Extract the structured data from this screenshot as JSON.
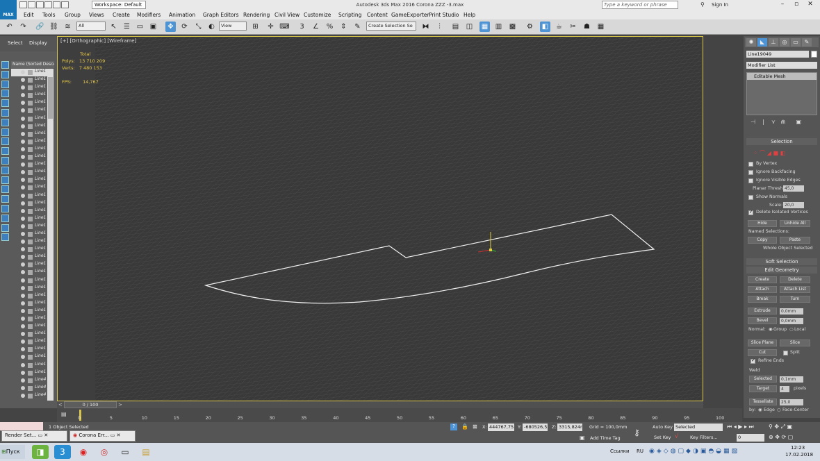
{
  "titlebar": {
    "logo": "MAX",
    "workspace": "Workspace: Default",
    "title": "Autodesk 3ds Max 2016     Corona ZZZ -3.max",
    "search_placeholder": "Type a keyword or phrase",
    "sign_in": "Sign In"
  },
  "menu": [
    "Edit",
    "Tools",
    "Group",
    "Views",
    "Create",
    "Modifiers",
    "Animation",
    "Graph Editors",
    "Rendering",
    "Civil View",
    "Customize",
    "Scripting",
    "Content",
    "GameExporter",
    "Print Studio",
    "Help"
  ],
  "toolbar": {
    "filter_value": "All",
    "view_value": "View",
    "selection_set_placeholder": "Create Selection Se"
  },
  "explorer": {
    "tab_select": "Select",
    "tab_display": "Display",
    "header": "Name (Sorted Desce",
    "items": [
      "Line1",
      "Line1",
      "Line1",
      "Line1",
      "Line1",
      "Line1",
      "Line1",
      "Line1",
      "Line1",
      "Line1",
      "Line1",
      "Line1",
      "Line1",
      "Line1",
      "Line1",
      "Line1",
      "Line1",
      "Line1",
      "Line1",
      "Line1",
      "Line1",
      "Line1",
      "Line1",
      "Line1",
      "Line1",
      "Line1",
      "Line1",
      "Line1",
      "Line1",
      "Line1",
      "Line1",
      "Line1",
      "Line1",
      "Line1",
      "Line1",
      "Line1",
      "Line1",
      "Line1",
      "Line1",
      "Line1",
      "Line4",
      "Line4",
      "Line4"
    ]
  },
  "viewport": {
    "label": "[+] [Orthographic] [Wireframe]",
    "stats_header": "Total",
    "polys_label": "Polys:",
    "polys_value": "13 710 209",
    "verts_label": "Verts:",
    "verts_value": "7 480 153",
    "fps_label": "FPS:",
    "fps_value": "14,767"
  },
  "command_panel": {
    "object_name": "Line19049",
    "modifier_list": "Modifier List",
    "stack_item": "Editable Mesh",
    "selection_title": "Selection",
    "by_vertex": "By Vertex",
    "ignore_backfacing": "Ignore Backfacing",
    "ignore_visible_edges": "Ignore Visible Edges",
    "planar_thresh_label": "Planar Thresh:",
    "planar_thresh_value": "45,0",
    "show_normals": "Show Normals",
    "scale_label": "Scale:",
    "scale_value": "20,0",
    "delete_isolated": "Delete Isolated Vertices",
    "hide": "Hide",
    "unhide_all": "Unhide All",
    "named_selections": "Named Selections:",
    "copy": "Copy",
    "paste": "Paste",
    "selection_status": "Whole Object Selected",
    "soft_selection": "Soft Selection",
    "edit_geometry": "Edit Geometry",
    "create": "Create",
    "delete": "Delete",
    "attach": "Attach",
    "attach_list": "Attach List",
    "break": "Break",
    "turn": "Turn",
    "extrude": "Extrude",
    "extrude_value": "0,0mm",
    "bevel": "Bevel",
    "bevel_value": "0,0mm",
    "normal_label": "Normal:",
    "group_label": "Group",
    "local_label": "Local",
    "slice_plane": "Slice Plane",
    "slice": "Slice",
    "cut": "Cut",
    "split": "Split",
    "refine_ends": "Refine Ends",
    "weld": "Weld",
    "selected": "Selected",
    "selected_value": "0,1mm",
    "target": "Target",
    "target_value": "4",
    "pixels": "pixels",
    "tessellate": "Tessellate",
    "tessellate_value": "25,0",
    "by_label": "by:",
    "edge_label": "Edge",
    "face_center": "Face-Center"
  },
  "timeline": {
    "frame": "0 / 100",
    "ticks": [
      "0",
      "5",
      "10",
      "15",
      "20",
      "25",
      "30",
      "35",
      "40",
      "45",
      "50",
      "55",
      "60",
      "65",
      "70",
      "75",
      "80",
      "85",
      "90",
      "95",
      "100"
    ]
  },
  "status": {
    "objects_selected": "1 Object Selected",
    "x_label": "X:",
    "x_value": "444767,75",
    "y_label": "Y:",
    "y_value": "-680526,5",
    "z_label": "Z:",
    "z_value": "3315,824n",
    "grid": "Grid = 100,0mm",
    "add_time_tag": "Add Time Tag",
    "auto_key": "Auto Key",
    "set_key": "Set Key",
    "selected_dropdown": "Selected",
    "key_filters": "Key Filters...",
    "frame_value": "0"
  },
  "mini_windows": [
    "Render Set...",
    "Corona Err..."
  ],
  "taskbar": {
    "start": "Пуск",
    "links": "Ссылки",
    "lang": "RU",
    "time": "12:23",
    "date": "17.02.2018"
  },
  "colors": {
    "accent": "#4e94d4",
    "viewport_border": "#d9c84c",
    "stats": "#e7c84a"
  }
}
